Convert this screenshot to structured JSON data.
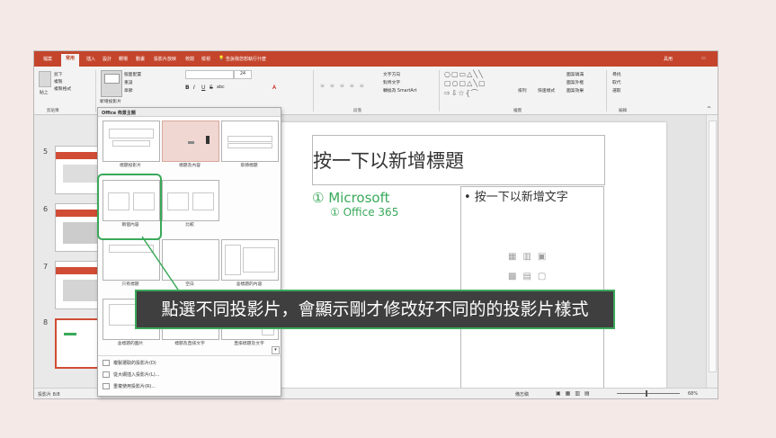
{
  "tabs": [
    "檔案",
    "常用",
    "插入",
    "設計",
    "轉場",
    "動畫",
    "投影片放映",
    "校閱",
    "檢視"
  ],
  "search_text": "告訴我您想執行什麼",
  "user_name": "具用",
  "ribbon": {
    "clipboard": {
      "paste": "貼上",
      "cut": "剪下",
      "copy": "複製",
      "format_painter": "複製格式",
      "group": "剪貼簿"
    },
    "slides": {
      "new_slide": "新增投影片",
      "layout": "版面配置",
      "reset": "重設",
      "section": "章節"
    },
    "font": {
      "size": "24",
      "bold": "B",
      "italic": "I",
      "underline": "U",
      "strike": "S",
      "char_spacing": "abc",
      "font_color": "A"
    },
    "paragraph": {
      "text_direction": "文字方向",
      "align_text": "對齊文字",
      "smartart": "轉換為 SmartArt",
      "group": "段落"
    },
    "drawing": {
      "arrange": "排列",
      "quick_styles": "快速樣式",
      "shape_fill": "圖案填滿",
      "shape_outline": "圖案外框",
      "shape_effects": "圖案效果",
      "group": "繪圖"
    },
    "editing": {
      "find": "尋找",
      "replace": "取代",
      "select": "選取",
      "group": "編輯"
    }
  },
  "panel": {
    "title": "Office 佈景主題",
    "layouts": [
      "標題投影片",
      "標題及內容",
      "章節標題",
      "兩個內容",
      "比較",
      "只有標題",
      "空白",
      "含標題的內容",
      "含標題的圖片",
      "標題及直排文字",
      "直排標題及文字"
    ],
    "content_tag": "內容",
    "tooltip": "兩個內容",
    "menu": [
      "複製選取的投影片(D)",
      "從大綱插入投影片(L)...",
      "重複使用投影片(R)..."
    ]
  },
  "thumb_numbers": [
    "5",
    "6",
    "7",
    "8"
  ],
  "slide": {
    "title": "按一下以新增標題",
    "left_item1": "Microsoft",
    "left_item2": "Office 365",
    "right_text": "• 按一下以新增文字"
  },
  "status": {
    "slide_info": "投影片 8/8",
    "notes": "備忘稿",
    "zoom": "68%"
  },
  "callout_text": "點選不同投影片，會顯示剛才修改好不同的的投影片樣式",
  "colors": {
    "accent": "#c4452c",
    "highlight_green": "#3aa95a",
    "callout_bg": "#3f3f3f"
  }
}
